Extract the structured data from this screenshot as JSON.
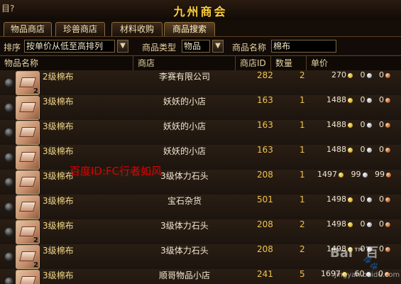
{
  "window": {
    "left_label": "目?",
    "title": "九州商会"
  },
  "tabs": [
    {
      "label": "物品商店",
      "active": false
    },
    {
      "label": "珍兽商店",
      "active": false
    },
    {
      "label": "材料收购",
      "active": false
    },
    {
      "label": "商品搜索",
      "active": true
    }
  ],
  "filters": {
    "sort_label": "排序",
    "sort_value": "按单价从低至高排列",
    "type_label": "商品类型",
    "type_value": "物品",
    "name_label": "商品名称",
    "name_value": "棉布"
  },
  "table": {
    "headers": [
      "物品名称",
      "商店",
      "商店ID",
      "数量",
      "单价"
    ],
    "rows": [
      {
        "qty_badge": "2",
        "item": "2级棉布",
        "shop": "李赛有限公司",
        "shop_id": "282",
        "count": "2",
        "gold": "270",
        "silver": "0",
        "copper": "0"
      },
      {
        "qty_badge": "",
        "item": "3级棉布",
        "shop": "妖妖的小店",
        "shop_id": "163",
        "count": "1",
        "gold": "1488",
        "silver": "0",
        "copper": "0"
      },
      {
        "qty_badge": "",
        "item": "3级棉布",
        "shop": "妖妖的小店",
        "shop_id": "163",
        "count": "1",
        "gold": "1488",
        "silver": "0",
        "copper": "0"
      },
      {
        "qty_badge": "",
        "item": "3级棉布",
        "shop": "妖妖的小店",
        "shop_id": "163",
        "count": "1",
        "gold": "1488",
        "silver": "0",
        "copper": "0"
      },
      {
        "qty_badge": "",
        "item": "3级棉布",
        "shop": "3级体力石头",
        "shop_id": "208",
        "count": "1",
        "gold": "1497",
        "silver": "99",
        "copper": "99"
      },
      {
        "qty_badge": "",
        "item": "3级棉布",
        "shop": "宝石杂货",
        "shop_id": "501",
        "count": "1",
        "gold": "1498",
        "silver": "0",
        "copper": "0"
      },
      {
        "qty_badge": "2",
        "item": "3级棉布",
        "shop": "3级体力石头",
        "shop_id": "208",
        "count": "2",
        "gold": "1498",
        "silver": "0",
        "copper": "0"
      },
      {
        "qty_badge": "2",
        "item": "3级棉布",
        "shop": "3级体力石头",
        "shop_id": "208",
        "count": "2",
        "gold": "1498",
        "silver": "0",
        "copper": "0"
      },
      {
        "qty_badge": "5",
        "item": "3级棉布",
        "shop": "顺哥物品小店",
        "shop_id": "241",
        "count": "5",
        "gold": "1697",
        "silver": "60",
        "copper": "0"
      }
    ]
  },
  "watermark": {
    "text": "百度ID:FC行者如风",
    "baidu_logo": "Bai™百",
    "baidu_sub": "jingyan.baidu.com"
  }
}
